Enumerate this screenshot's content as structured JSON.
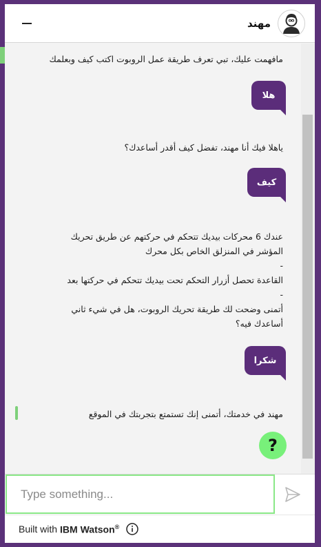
{
  "header": {
    "bot_name": "مهند",
    "minimize_icon": "minimize-icon",
    "avatar_icon": "user-avatar-icon"
  },
  "messages": {
    "bot_1": "مافهمت عليك، تبي تعرف طريقة عمل الروبوت اكتب كيف وبعلمك",
    "user_1": "هلا",
    "bot_2": "ياهلا فيك أنا مهند، تفضل كيف أقدر أساعدك؟",
    "user_2": "كيف",
    "bot_3": "عندك 6 محركات بيديك تتحكم في حركتهم عن طريق تحريك\nالمؤشر في المنزلق الخاص بكل محرك\n-\nالقاعدة تحصل أزرار التحكم تحت بيديك تتحكم في حركتها بعد\n-\nأتمنى وضحت لك طريقة تحريك الروبوت، هل في شيء ثاني\nأساعدك فيه؟",
    "user_3": "شكرا",
    "bot_4": "مهند في خدمتك، أتمنى إنك تستمتع بتجربتك في الموقع"
  },
  "help_button": {
    "label": "?"
  },
  "input": {
    "placeholder": "Type something...",
    "send_icon": "send-icon"
  },
  "footer": {
    "built_with": "Built with",
    "brand": "IBM Watson",
    "reg_mark": "®",
    "info_icon": "info-icon"
  },
  "colors": {
    "frame": "#5b3179",
    "user_bubble": "#5b2d7a",
    "accent_green": "#7ed07a",
    "help_button": "#78f07a",
    "chat_background": "#f3f3f3"
  }
}
